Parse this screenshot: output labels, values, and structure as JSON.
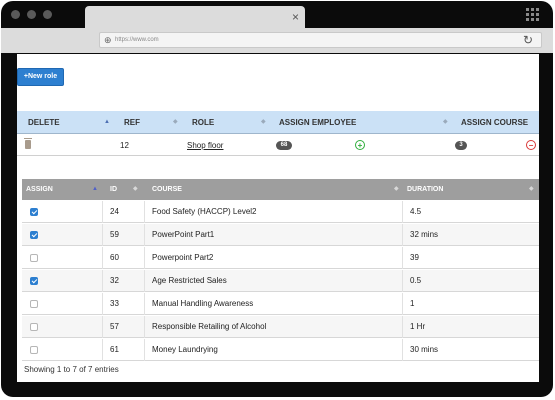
{
  "browser": {
    "url": "https://www.com"
  },
  "toolbar": {
    "new_role_label": "+New role"
  },
  "roles_table": {
    "headers": [
      "DELETE",
      "REF",
      "ROLE",
      "ASSIGN EMPLOYEE",
      "ASSIGN COURSE"
    ],
    "row": {
      "ref": "12",
      "role": "Shop floor",
      "employee_count": "68",
      "course_count": "3"
    }
  },
  "courses_table": {
    "headers": [
      "ASSIGN",
      "ID",
      "COURSE",
      "DURATION"
    ],
    "rows": [
      {
        "checked": true,
        "id": "24",
        "course": "Food Safety (HACCP) Level2",
        "duration": "4.5"
      },
      {
        "checked": true,
        "id": "59",
        "course": "PowerPoint Part1",
        "duration": "32 mins"
      },
      {
        "checked": false,
        "id": "60",
        "course": "Powerpoint Part2",
        "duration": "39"
      },
      {
        "checked": true,
        "id": "32",
        "course": "Age Restricted Sales",
        "duration": "0.5"
      },
      {
        "checked": false,
        "id": "33",
        "course": "Manual Handling Awareness",
        "duration": "1"
      },
      {
        "checked": false,
        "id": "57",
        "course": "Responsible Retailing of Alcohol",
        "duration": "1 Hr"
      },
      {
        "checked": false,
        "id": "61",
        "course": "Money Laundrying",
        "duration": "30 mins"
      }
    ],
    "footer": "Showing 1 to 7 of 7 entries"
  },
  "icons": {
    "tab_close": "×",
    "globe": "⊕",
    "reload": "↻",
    "add": "+",
    "remove": "−",
    "sort_asc": "▲",
    "sort_both": "◆"
  },
  "colors": {
    "accent": "#2d7fd0",
    "roles_header": "#cbe1f6",
    "courses_header": "#9e9e9e",
    "add_green": "#2fae3c",
    "remove_red": "#d93838"
  }
}
